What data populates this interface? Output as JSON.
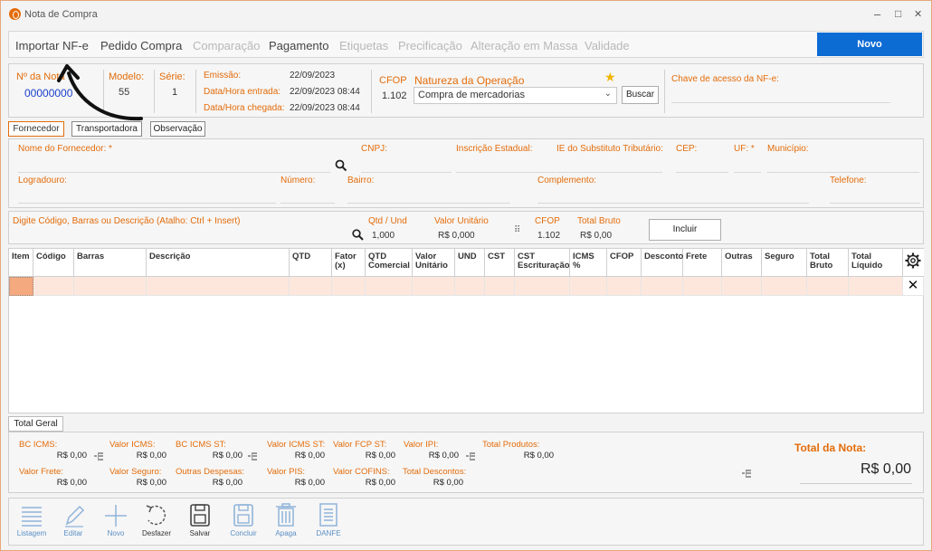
{
  "window": {
    "title": "Nota de Compra",
    "minimize": "–",
    "maximize": "□",
    "close": "✕"
  },
  "top_tabs": [
    {
      "label": "Importar NF-e",
      "state": "active"
    },
    {
      "label": "Pedido Compra",
      "state": "active"
    },
    {
      "label": "Comparação",
      "state": "disabled"
    },
    {
      "label": "Pagamento",
      "state": "active"
    },
    {
      "label": "Etiquetas",
      "state": "disabled"
    },
    {
      "label": "Precificação",
      "state": "disabled"
    },
    {
      "label": "Alteração em Massa",
      "state": "disabled"
    },
    {
      "label": "Validade",
      "state": "disabled"
    }
  ],
  "novo_label": "Novo",
  "header": {
    "nota_label": "Nº da Nota",
    "nota_value": "00000000",
    "modelo_label": "Modelo:",
    "modelo_value": "55",
    "serie_label": "Série:",
    "serie_value": "1",
    "emissao_label": "Emissão:",
    "emissao_value": "22/09/2023",
    "entrada_label": "Data/Hora entrada:",
    "entrada_value": "22/09/2023  08:44",
    "chegada_label": "Data/Hora chegada:",
    "chegada_value": "22/09/2023  08:44",
    "cfop_label": "CFOP",
    "cfop_value": "1.102",
    "natureza_label": "Natureza da Operação",
    "natureza_value": "Compra de mercadorias",
    "buscar_label": "Buscar",
    "chave_label": "Chave de acesso da NF-e:"
  },
  "sub_tabs": [
    "Fornecedor",
    "Transportadora",
    "Observação"
  ],
  "fornecedor": {
    "nome_label": "Nome do Fornecedor: *",
    "cnpj_label": "CNPJ:",
    "ie_label": "Inscrição Estadual:",
    "iest_label": "IE do Substituto Tributário:",
    "cep_label": "CEP:",
    "uf_label": "UF: *",
    "municipio_label": "Município:",
    "logradouro_label": "Logradouro:",
    "numero_label": "Número:",
    "bairro_label": "Bairro:",
    "complemento_label": "Complemento:",
    "telefone_label": "Telefone:"
  },
  "item_entry": {
    "search_label": "Digite Código, Barras ou Descrição (Atalho: Ctrl + Insert)",
    "qtd_label": "Qtd / Und",
    "qtd_value": "1,000",
    "vu_label": "Valor Unitário",
    "vu_value": "R$ 0,000",
    "cfop_label": "CFOP",
    "cfop_value": "1.102",
    "tb_label": "Total Bruto",
    "tb_value": "R$ 0,00",
    "incluir_label": "Incluir"
  },
  "grid_columns": [
    "Item",
    "Código",
    "Barras",
    "Descrição",
    "QTD",
    "Fator (x)",
    "QTD Comercial",
    "Valor Unitário",
    "UND",
    "CST",
    "CST Escrituração",
    "ICMS %",
    "CFOP",
    "Desconto",
    "Frete",
    "Outras",
    "Seguro",
    "Total Bruto",
    "Total Líquido"
  ],
  "delete_glyph": "✕",
  "total_tab": "Total Geral",
  "totals": {
    "bc_icms": {
      "label": "BC ICMS:",
      "value": "R$ 0,00"
    },
    "valor_icms": {
      "label": "Valor ICMS:",
      "value": "R$ 0,00"
    },
    "bc_icms_st": {
      "label": "BC ICMS ST:",
      "value": "R$ 0,00"
    },
    "valor_icms_st": {
      "label": "Valor ICMS ST:",
      "value": "R$ 0,00"
    },
    "valor_fcp_st": {
      "label": "Valor FCP ST:",
      "value": "R$ 0,00"
    },
    "valor_ipi": {
      "label": "Valor IPI:",
      "value": "R$ 0,00"
    },
    "total_produtos": {
      "label": "Total Produtos:",
      "value": "R$ 0,00"
    },
    "valor_frete": {
      "label": "Valor Frete:",
      "value": "R$ 0,00"
    },
    "valor_seguro": {
      "label": "Valor Seguro:",
      "value": "R$ 0,00"
    },
    "outras_despesas": {
      "label": "Outras Despesas:",
      "value": "R$ 0,00"
    },
    "valor_pis": {
      "label": "Valor PIS:",
      "value": "R$ 0,00"
    },
    "valor_cofins": {
      "label": "Valor COFINS:",
      "value": "R$ 0,00"
    },
    "total_descontos": {
      "label": "Total Descontos:",
      "value": "R$ 0,00"
    },
    "total_nota_label": "Total da Nota:",
    "total_nota_value": "R$ 0,00"
  },
  "toolbar": [
    "Listagem",
    "Editar",
    "Novo",
    "Desfazer",
    "Salvar",
    "Concluir",
    "Apaga",
    "DANFE"
  ],
  "colors": {
    "accent": "#e36c0a",
    "primary": "#0d6bd4",
    "row": "#fde7dc"
  }
}
